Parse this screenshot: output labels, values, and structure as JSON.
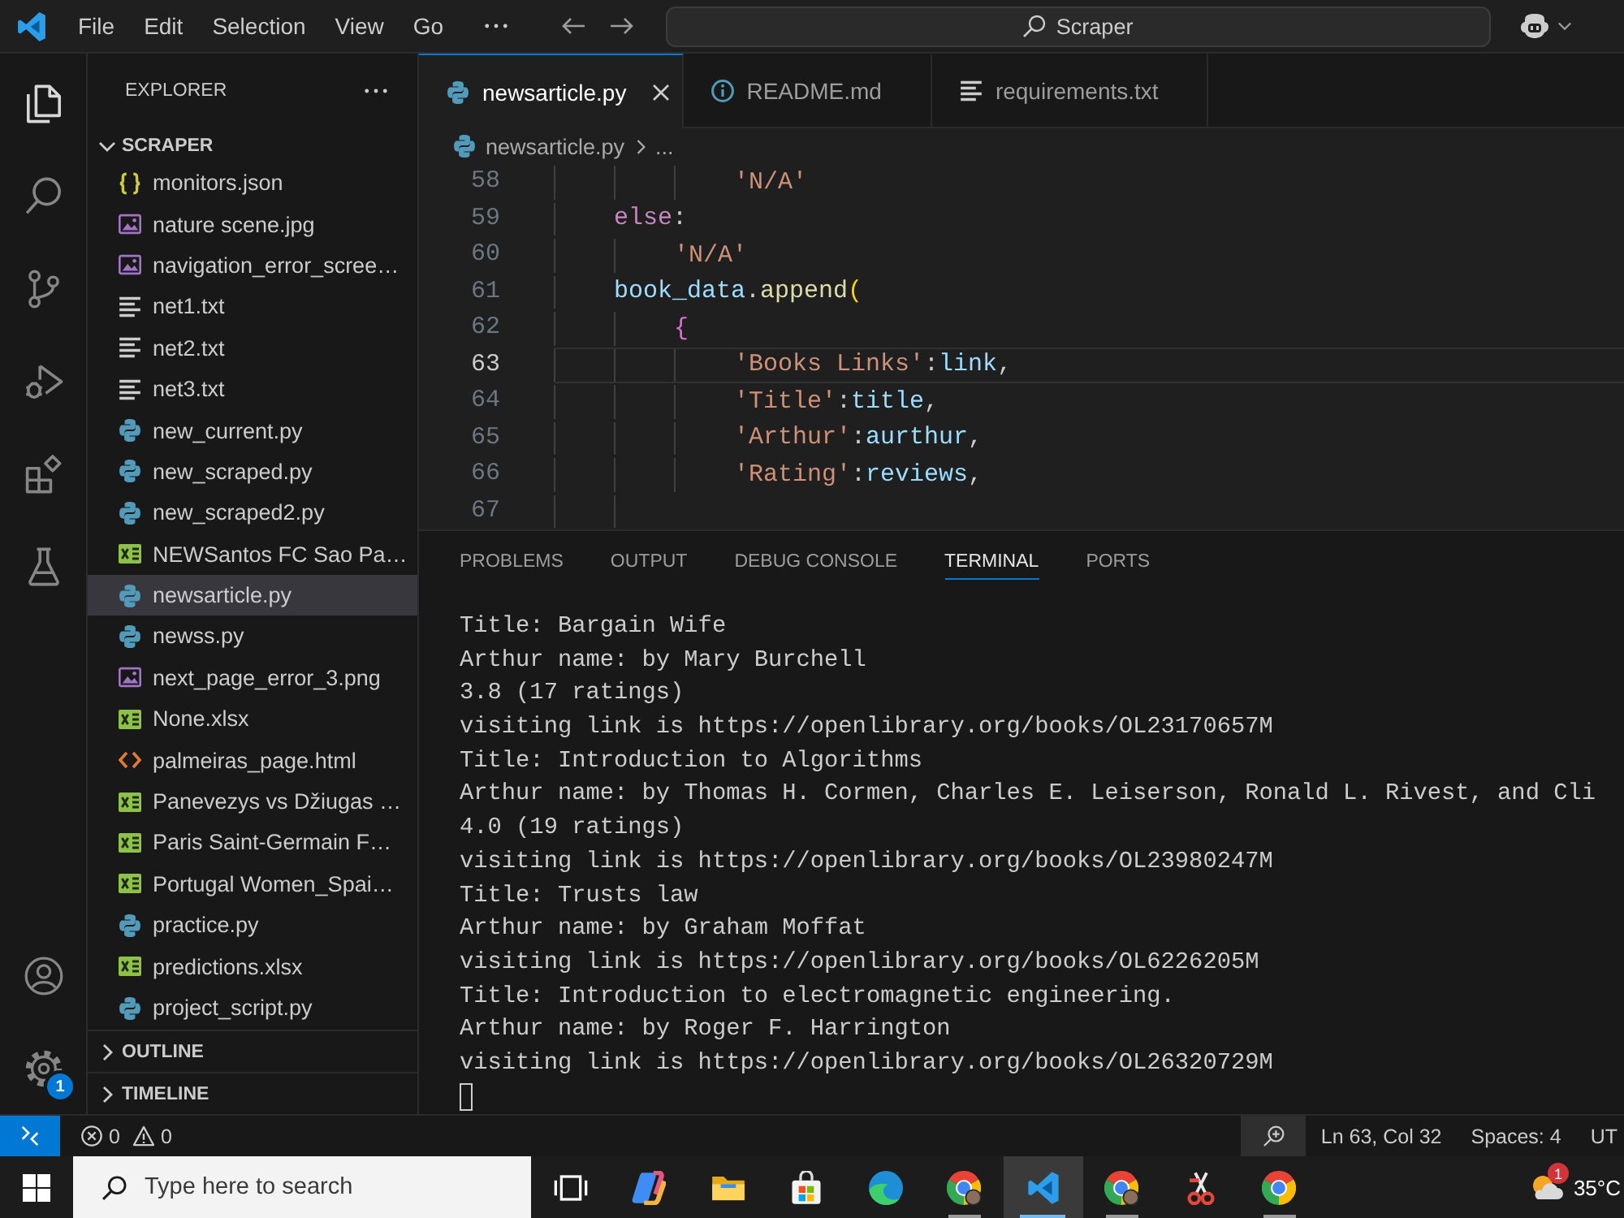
{
  "title_bar": {
    "menu": [
      "File",
      "Edit",
      "Selection",
      "View",
      "Go"
    ],
    "command_center": "Scraper"
  },
  "activity_bar": {
    "items": [
      {
        "kind": "explorer",
        "selected": true
      },
      {
        "kind": "search",
        "selected": false
      },
      {
        "kind": "source_control",
        "selected": false
      },
      {
        "kind": "run_debug",
        "selected": false
      },
      {
        "kind": "extensions",
        "selected": false
      },
      {
        "kind": "testing",
        "selected": false
      }
    ],
    "bottom_items": [
      {
        "kind": "accounts",
        "selected": false
      },
      {
        "kind": "manage",
        "selected": false,
        "badge": "1"
      }
    ]
  },
  "sidebar": {
    "title": "EXPLORER",
    "folder": {
      "name": "SCRAPER",
      "expanded": true
    },
    "files": [
      {
        "name": "monitors.json",
        "kind": "json",
        "selected": false
      },
      {
        "name": "nature scene.jpg",
        "kind": "image",
        "selected": false
      },
      {
        "name": "navigation_error_scree…",
        "kind": "image",
        "selected": false
      },
      {
        "name": "net1.txt",
        "kind": "text",
        "selected": false
      },
      {
        "name": "net2.txt",
        "kind": "text",
        "selected": false
      },
      {
        "name": "net3.txt",
        "kind": "text",
        "selected": false
      },
      {
        "name": "new_current.py",
        "kind": "python",
        "selected": false
      },
      {
        "name": "new_scraped.py",
        "kind": "python",
        "selected": false
      },
      {
        "name": "new_scraped2.py",
        "kind": "python",
        "selected": false
      },
      {
        "name": "NEWSantos FC Sao Pa…",
        "kind": "excel",
        "selected": false
      },
      {
        "name": "newsarticle.py",
        "kind": "python",
        "selected": true
      },
      {
        "name": "newss.py",
        "kind": "python",
        "selected": false
      },
      {
        "name": "next_page_error_3.png",
        "kind": "image",
        "selected": false
      },
      {
        "name": "None.xlsx",
        "kind": "excel",
        "selected": false
      },
      {
        "name": "palmeiras_page.html",
        "kind": "html",
        "selected": false
      },
      {
        "name": "Panevezys vs Džiugas …",
        "kind": "excel",
        "selected": false
      },
      {
        "name": "Paris Saint-Germain F…",
        "kind": "excel",
        "selected": false
      },
      {
        "name": "Portugal Women_Spai…",
        "kind": "excel",
        "selected": false
      },
      {
        "name": "practice.py",
        "kind": "python",
        "selected": false
      },
      {
        "name": "predictions.xlsx",
        "kind": "excel",
        "selected": false
      },
      {
        "name": "project_script.py",
        "kind": "python",
        "selected": false
      }
    ],
    "sections": [
      {
        "name": "OUTLINE",
        "expanded": false
      },
      {
        "name": "TIMELINE",
        "expanded": false
      }
    ]
  },
  "editor": {
    "tabs": [
      {
        "label": "newsarticle.py",
        "kind": "python",
        "selected": true
      },
      {
        "label": "README.md",
        "kind": "info",
        "selected": false
      },
      {
        "label": "requirements.txt",
        "kind": "text",
        "selected": false
      }
    ],
    "breadcrumb": {
      "kind": "python",
      "file": "newsarticle.py",
      "rest": "..."
    },
    "lines": [
      {
        "number": "58",
        "current": false,
        "tokens": [
          {
            "kind": "string",
            "text": "            'N/A'"
          }
        ]
      },
      {
        "number": "59",
        "current": false,
        "tokens": [
          {
            "kind": "keyword",
            "text": "    else"
          },
          {
            "kind": "punct",
            "text": ":"
          }
        ]
      },
      {
        "number": "60",
        "current": false,
        "tokens": [
          {
            "kind": "string",
            "text": "        'N/A'"
          }
        ]
      },
      {
        "number": "61",
        "current": false,
        "tokens": [
          {
            "kind": "variable",
            "text": "    book_data"
          },
          {
            "kind": "punct",
            "text": "."
          },
          {
            "kind": "function",
            "text": "append"
          },
          {
            "kind": "bracket1",
            "text": "("
          }
        ]
      },
      {
        "number": "62",
        "current": false,
        "tokens": [
          {
            "kind": "bracket2",
            "text": "        {"
          }
        ]
      },
      {
        "number": "63",
        "current": true,
        "tokens": [
          {
            "kind": "string",
            "text": "            'Books Links'"
          },
          {
            "kind": "punct",
            "text": ":"
          },
          {
            "kind": "variable",
            "text": "link"
          },
          {
            "kind": "punct",
            "text": ","
          }
        ]
      },
      {
        "number": "64",
        "current": false,
        "tokens": [
          {
            "kind": "string",
            "text": "            'Title'"
          },
          {
            "kind": "punct",
            "text": ":"
          },
          {
            "kind": "variable",
            "text": "title"
          },
          {
            "kind": "punct",
            "text": ","
          }
        ]
      },
      {
        "number": "65",
        "current": false,
        "tokens": [
          {
            "kind": "string",
            "text": "            'Arthur'"
          },
          {
            "kind": "punct",
            "text": ":"
          },
          {
            "kind": "variable",
            "text": "aurthur"
          },
          {
            "kind": "punct",
            "text": ","
          }
        ]
      },
      {
        "number": "66",
        "current": false,
        "tokens": [
          {
            "kind": "string",
            "text": "            'Rating'"
          },
          {
            "kind": "punct",
            "text": ":"
          },
          {
            "kind": "variable",
            "text": "reviews"
          },
          {
            "kind": "punct",
            "text": ","
          }
        ]
      },
      {
        "number": "67",
        "current": false
      }
    ]
  },
  "panel": {
    "tabs": [
      {
        "label": "PROBLEMS",
        "selected": false
      },
      {
        "label": "OUTPUT",
        "selected": false
      },
      {
        "label": "DEBUG CONSOLE",
        "selected": false
      },
      {
        "label": "TERMINAL",
        "selected": true
      },
      {
        "label": "PORTS",
        "selected": false
      }
    ],
    "terminal_lines": [
      "Title: Bargain Wife",
      "Arthur name: by Mary Burchell",
      "3.8 (17 ratings)",
      "visiting link is https://openlibrary.org/books/OL23170657M",
      "Title: Introduction to Algorithms",
      "Arthur name: by Thomas H. Cormen, Charles E. Leiserson, Ronald L. Rivest, and Cli",
      "4.0 (19 ratings)",
      "visiting link is https://openlibrary.org/books/OL23980247M",
      "Title: Trusts law",
      "Arthur name: by Graham Moffat",
      "visiting link is https://openlibrary.org/books/OL6226205M",
      "Title: Introduction to electromagnetic engineering.",
      "Arthur name: by Roger F. Harrington",
      "visiting link is https://openlibrary.org/books/OL26320729M"
    ]
  },
  "status_bar": {
    "errors": "0",
    "warnings": "0",
    "position": "Ln 63, Col 32",
    "indentation": "Spaces: 4",
    "encoding": "UT"
  },
  "taskbar": {
    "search": {
      "placeholder": "Type here to search"
    },
    "apps": [
      {
        "kind": "task_view",
        "active": false,
        "running": false
      },
      {
        "kind": "copilot",
        "active": false,
        "running": false
      },
      {
        "kind": "file_explorer",
        "active": false,
        "running": false
      },
      {
        "kind": "store",
        "active": false,
        "running": false
      },
      {
        "kind": "edge",
        "active": false,
        "running": false
      },
      {
        "kind": "chrome",
        "profile": true,
        "active": false,
        "running": true
      },
      {
        "kind": "vscode",
        "active": true,
        "running": true
      },
      {
        "kind": "chrome",
        "profile": true,
        "active": false,
        "running": true
      },
      {
        "kind": "snipping",
        "active": false,
        "running": false
      },
      {
        "kind": "chrome",
        "profile": false,
        "active": false,
        "running": true
      }
    ],
    "weather": {
      "badge": "1",
      "temperature": "35°C"
    }
  }
}
